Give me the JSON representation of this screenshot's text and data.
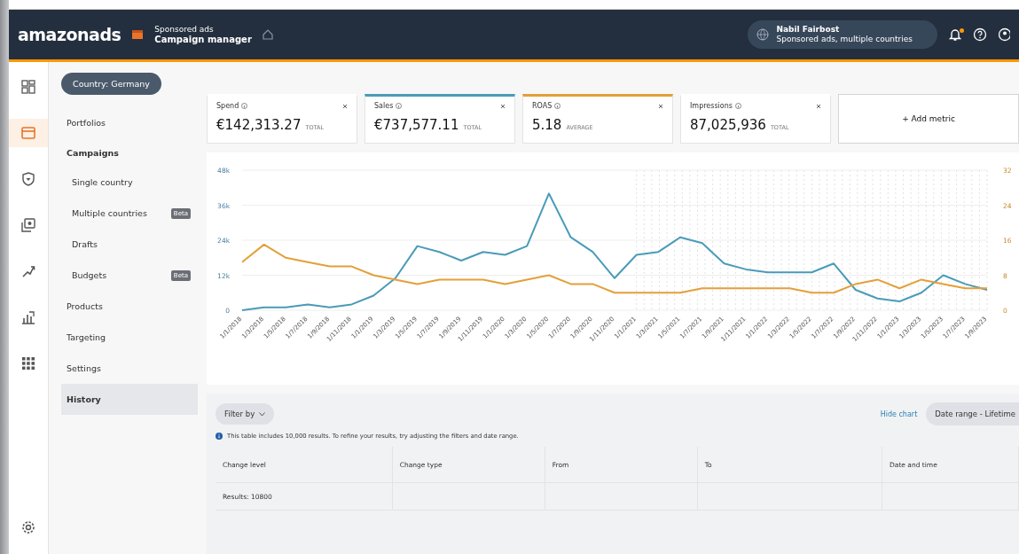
{
  "header": {
    "logo": "amazonads",
    "product_line": "Sponsored ads",
    "product": "Campaign manager",
    "account_name": "Nabil Fairbost",
    "account_scope": "Sponsored ads, multiple countries",
    "notification_dot": true
  },
  "rail": [
    {
      "kind": "dashboard",
      "selected": false
    },
    {
      "kind": "campaigns",
      "selected": true
    },
    {
      "kind": "shield",
      "selected": false
    },
    {
      "kind": "media",
      "selected": false
    },
    {
      "kind": "growth",
      "selected": false
    },
    {
      "kind": "reports",
      "selected": false
    },
    {
      "kind": "apps",
      "selected": false
    },
    {
      "kind": "settings",
      "selected": false
    }
  ],
  "country_filter": "Country: Germany",
  "sidebar": {
    "items": [
      {
        "label": "Portfolios",
        "kind": "link",
        "selected": false
      },
      {
        "label": "Campaigns",
        "kind": "heading",
        "selected": false
      },
      {
        "label": "Single country",
        "kind": "sub",
        "selected": false
      },
      {
        "label": "Multiple countries",
        "kind": "sub",
        "badge": "Beta",
        "selected": false
      },
      {
        "label": "Drafts",
        "kind": "sub",
        "selected": false
      },
      {
        "label": "Budgets",
        "kind": "sub",
        "badge": "Beta",
        "selected": false
      },
      {
        "label": "Products",
        "kind": "link",
        "selected": false
      },
      {
        "label": "Targeting",
        "kind": "link",
        "selected": false
      },
      {
        "label": "Settings",
        "kind": "link",
        "selected": false
      },
      {
        "label": "History",
        "kind": "link",
        "selected": true
      }
    ]
  },
  "metrics": [
    {
      "label": "Spend",
      "value": "€142,313.27",
      "qualifier": "TOTAL"
    },
    {
      "label": "Sales",
      "value": "€737,577.11",
      "qualifier": "TOTAL",
      "color": "#4a9bb8"
    },
    {
      "label": "ROAS",
      "value": "5.18",
      "qualifier": "AVERAGE",
      "color": "#e3a03a"
    },
    {
      "label": "Impressions",
      "value": "87,025,936",
      "qualifier": "TOTAL"
    }
  ],
  "add_metric": "+ Add metric",
  "chart": {
    "chart_data": {
      "type": "line",
      "categories": [
        "1/1/2018",
        "1/3/2018",
        "1/5/2018",
        "1/7/2018",
        "1/9/2018",
        "1/11/2018",
        "1/1/2019",
        "1/3/2019",
        "1/5/2019",
        "1/7/2019",
        "1/9/2019",
        "1/11/2019",
        "1/1/2020",
        "1/3/2020",
        "1/5/2020",
        "1/7/2020",
        "1/9/2020",
        "1/11/2020",
        "1/1/2021",
        "1/3/2021",
        "1/5/2021",
        "1/7/2021",
        "1/9/2021",
        "1/11/2021",
        "1/1/2022",
        "1/3/2022",
        "1/5/2022",
        "1/7/2022",
        "1/9/2022",
        "1/11/2022",
        "1/1/2023",
        "1/3/2023",
        "1/5/2023",
        "1/7/2023",
        "1/9/2023"
      ],
      "series": [
        {
          "color": "#4a9bb8",
          "values": [
            0,
            1000,
            1000,
            2000,
            1000,
            2000,
            5000,
            11000,
            22000,
            20000,
            17000,
            20000,
            19000,
            22000,
            40000,
            25000,
            20000,
            11000,
            19000,
            20000,
            25000,
            23000,
            16000,
            14000,
            13000,
            13000,
            13000,
            16000,
            7000,
            4000,
            3000,
            6000,
            12000,
            9000,
            7000
          ]
        },
        {
          "color": "#e3a03a",
          "axis": "y2",
          "values": [
            11,
            15,
            12,
            11,
            10,
            10,
            8,
            7,
            6,
            7,
            7,
            7,
            6,
            7,
            8,
            6,
            6,
            4,
            4,
            4,
            4,
            5,
            5,
            5,
            5,
            5,
            4,
            4,
            6,
            7,
            5,
            7,
            6,
            5,
            5
          ]
        }
      ],
      "ylim": [
        0,
        48000
      ],
      "yticks": [
        {
          "value": 0,
          "label": "0"
        },
        {
          "value": 12000,
          "label": "12k"
        },
        {
          "value": 24000,
          "label": "24k"
        },
        {
          "value": 36000,
          "label": "36k"
        },
        {
          "value": 48000,
          "label": "48k"
        }
      ],
      "grid": true,
      "y2lim": [
        0,
        32
      ],
      "y2ticks": [
        0,
        8,
        16,
        24,
        32
      ]
    }
  },
  "history": {
    "filter_button": "Filter by",
    "hide_chart": "Hide chart",
    "date_range": "Date range - Lifetime",
    "notice": "This table includes 10,000 results. To refine your results, try adjusting the filters and date range.",
    "columns": [
      "Change level",
      "Change type",
      "From",
      "To",
      "Date and time"
    ],
    "rows": [
      [
        "Results: 10800",
        "",
        "",
        "",
        ""
      ]
    ]
  }
}
